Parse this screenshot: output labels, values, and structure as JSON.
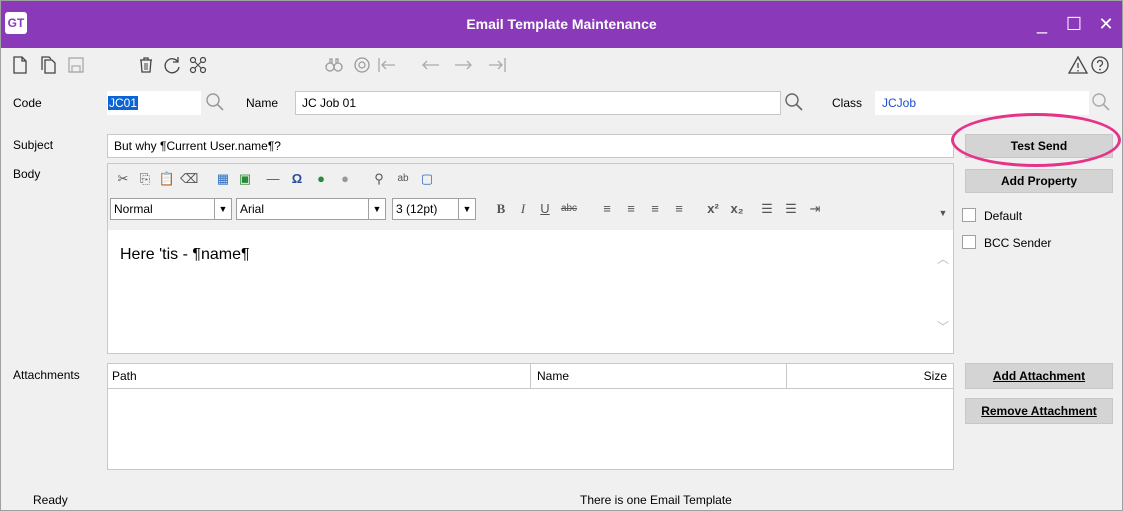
{
  "app": {
    "logo": "GT",
    "title": "Email Template Maintenance"
  },
  "window_controls": {
    "minimize": "_",
    "maximize": "☐",
    "close": "✕"
  },
  "toolbar": {
    "icons": [
      "new-document-icon",
      "copy-document-icon",
      "save-icon",
      "delete-icon",
      "refresh-icon",
      "network-icon",
      "find-icon",
      "navigate-icon",
      "first-record-icon",
      "previous-record-icon",
      "next-record-icon",
      "last-record-icon",
      "alert-icon",
      "help-icon"
    ]
  },
  "form": {
    "code_label": "Code",
    "code_value": "JC01",
    "name_label": "Name",
    "name_value": "JC Job 01",
    "class_label": "Class",
    "class_value": "JCJob",
    "subject_label": "Subject",
    "subject_value": "But why ¶Current User.name¶?",
    "body_label": "Body",
    "attachments_label": "Attachments"
  },
  "editor": {
    "paragraph_style": "Normal",
    "font": "Arial",
    "size": "3 (12pt)",
    "content": "Here 'tis - ¶name¶"
  },
  "buttons": {
    "test_send": "Test Send",
    "add_property": "Add Property",
    "add_attachment": "Add Attachment",
    "remove_attachment": "Remove Attachment"
  },
  "checkboxes": {
    "default": "Default",
    "bcc_sender": "BCC Sender"
  },
  "attachments_table": {
    "columns": [
      "Path",
      "Name",
      "Size"
    ],
    "rows": []
  },
  "status": {
    "left": "Ready",
    "center": "There is one Email Template"
  },
  "colors": {
    "titlebar": "#8a3ab9",
    "highlight_circle": "#e6338a",
    "selection": "#0a64d4",
    "link": "#1a4fd6"
  }
}
